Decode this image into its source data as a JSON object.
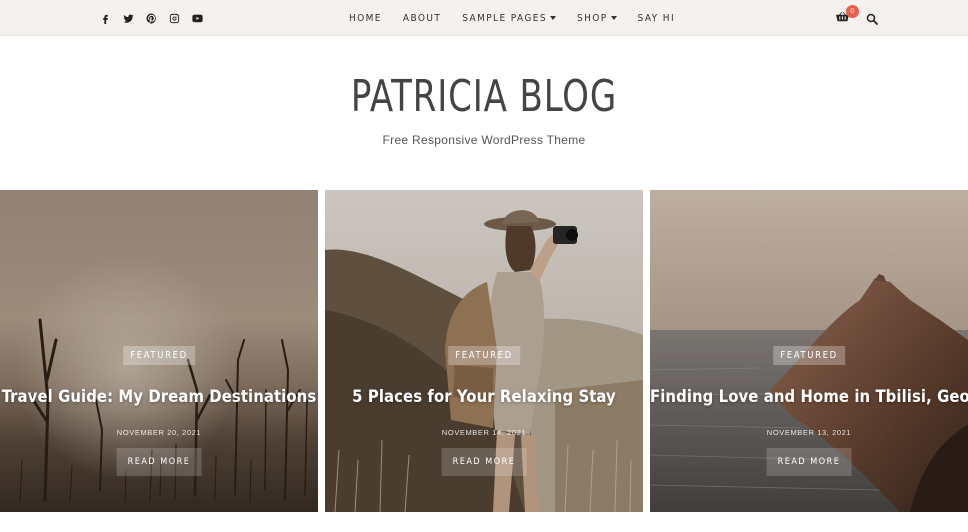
{
  "social": {
    "icons": [
      "facebook-icon",
      "twitter-icon",
      "pinterest-icon",
      "instagram-icon",
      "youtube-icon"
    ]
  },
  "nav": {
    "items": [
      {
        "label": "HOME",
        "has_dropdown": false
      },
      {
        "label": "ABOUT",
        "has_dropdown": false
      },
      {
        "label": "SAMPLE PAGES",
        "has_dropdown": true
      },
      {
        "label": "SHOP",
        "has_dropdown": true
      },
      {
        "label": "SAY HI",
        "has_dropdown": false
      }
    ]
  },
  "cart": {
    "count": "0",
    "icon": "cart-icon"
  },
  "search": {
    "icon": "search-icon"
  },
  "site": {
    "title": "PATRICIA BLOG",
    "tagline": "Free Responsive WordPress Theme"
  },
  "posts": [
    {
      "badge": "FEATURED",
      "title": "Travel Guide: My Dream Destinations",
      "date": "NOVEMBER 20, 2021",
      "read_more": "READ MORE"
    },
    {
      "badge": "FEATURED",
      "title": "5 Places for Your Relaxing Stay",
      "date": "NOVEMBER 14, 2021",
      "read_more": "READ MORE"
    },
    {
      "badge": "FEATURED",
      "title": "Finding Love and Home in Tbilisi, Georgia",
      "date": "NOVEMBER 13, 2021",
      "read_more": "READ MORE"
    }
  ],
  "colors": {
    "topbar_bg": "#f5f1ee",
    "cart_badge": "#e8604c",
    "text_dark": "#444444"
  }
}
